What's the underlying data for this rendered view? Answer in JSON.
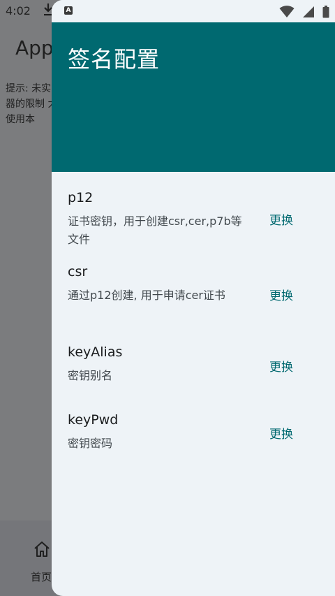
{
  "background": {
    "time": "4:02",
    "title": "App",
    "tip": "提示: 未实 务器的限制 大陆使用本",
    "nav_home_label": "首页"
  },
  "drawer": {
    "title": "签名配置",
    "items": [
      {
        "title": "p12",
        "desc": "证书密钥，用于创建csr,cer,p7b等文件",
        "action": "更换"
      },
      {
        "title": "csr",
        "desc": "通过p12创建, 用于申请cer证书",
        "action": "更换"
      },
      {
        "title": "keyAlias",
        "desc": "密钥别名",
        "action": "更换"
      },
      {
        "title": "keyPwd",
        "desc": "密钥密码",
        "action": "更换"
      }
    ]
  },
  "colors": {
    "header": "#006970",
    "accent": "#006970",
    "drawer_bg": "#eef3f7",
    "scrim": "#7b7c7e"
  },
  "icons": {
    "status": [
      "notification-a-icon",
      "wifi-icon",
      "signal-icon",
      "battery-icon"
    ],
    "background": [
      "download-icon",
      "home-icon"
    ]
  }
}
